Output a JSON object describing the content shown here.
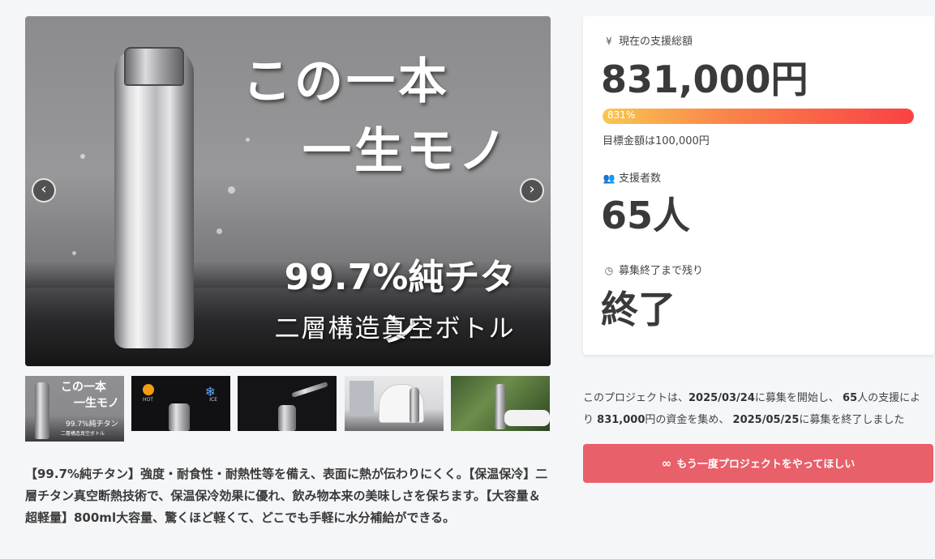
{
  "hero": {
    "headline_line1": "この一本",
    "headline_line2": "一生モノ",
    "purity": "99.7%純チタン",
    "subtitle": "二層構造真空ボトル",
    "prev_icon": "chevron-left-icon",
    "next_icon": "chevron-right-icon"
  },
  "thumbnails": [
    {
      "line1": "この一本",
      "line2": "一生モノ",
      "line3": "99.7%純チタン",
      "line4": "二層構造真空ボトル"
    },
    {
      "hot": "HOT",
      "cold": "ICE"
    },
    {},
    {},
    {}
  ],
  "description": "【99.7%純チタン】強度・耐食性・耐熱性等を備え、表面に熱が伝わりにくく。【保温保冷】二層チタン真空断熱技術で、保温保冷効果に優れ、飲み物本来の美味しさを保ちます。【大容量＆超軽量】800ml大容量、驚くほど軽くて、どこでも手軽に水分補給ができる。",
  "stats": {
    "funding_label": "現在の支援総額",
    "funding_icon": "yen-icon",
    "funding_amount": "831,000円",
    "progress_percent": "831%",
    "progress_value": 831,
    "goal_text": "目標金額は100,000円",
    "backers_label": "支援者数",
    "backers_icon": "users-icon",
    "backers_count": "65人",
    "remaining_label": "募集終了まで残り",
    "remaining_icon": "clock-icon",
    "remaining_value": "終了"
  },
  "summary": {
    "part1": "このプロジェクトは、",
    "start_date": "2025/03/24",
    "part2": "に募集を開始し、",
    "backers": "65",
    "part3": "人の支援により",
    "amount": "831,000",
    "part4": "円の資金を集め、",
    "end_date": "2025/05/25",
    "part5": "に募集を終了しました"
  },
  "cta": {
    "icon": "infinity-icon",
    "label": "もう一度プロジェクトをやってほしい"
  },
  "colors": {
    "cta": "#e8606a",
    "progress_start": "#f9c74f",
    "progress_end": "#f94144"
  }
}
